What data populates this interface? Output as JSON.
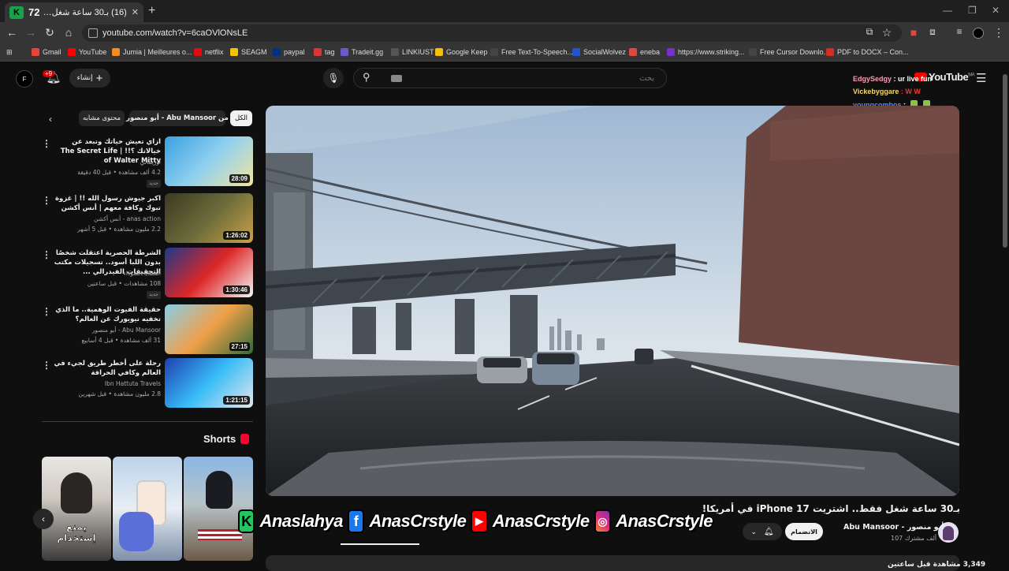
{
  "browser": {
    "tab_title": "(16) بـ30 ساعة شغل فقط...",
    "tab_badge": "72",
    "url": "youtube.com/watch?v=6caOVlONsLE",
    "bookmarks": [
      {
        "label": "Gmail",
        "color": "#ea4335"
      },
      {
        "label": "YouTube",
        "color": "#ff0000"
      },
      {
        "label": "Jumia | Meilleures o...",
        "color": "#f68b1e"
      },
      {
        "label": "netflix",
        "color": "#e50914"
      },
      {
        "label": "SEAGM",
        "color": "#f5c400"
      },
      {
        "label": "paypal",
        "color": "#003087"
      },
      {
        "label": "tag",
        "color": "#d33"
      },
      {
        "label": "Tradeit.gg",
        "color": "#6a5acd"
      },
      {
        "label": "LINKIUST",
        "color": "#555"
      },
      {
        "label": "Google Keep",
        "color": "#fbbc04"
      },
      {
        "label": "Free Text-To-Speech...",
        "color": "#444"
      },
      {
        "label": "SocialWolvez",
        "color": "#2255cc"
      },
      {
        "label": "eneba",
        "color": "#e0483d"
      },
      {
        "label": "https://www.striking...",
        "color": "#7a2fd0"
      },
      {
        "label": "Free Cursor Downlo...",
        "color": "#444"
      },
      {
        "label": "PDF to DOCX – Con...",
        "color": "#d62d20"
      }
    ]
  },
  "header": {
    "avatar_letter": "F",
    "notif_count": "+9",
    "create_label": "إنشاء",
    "search_placeholder": "بحث",
    "logo_text": "YouTube",
    "logo_region": "MA"
  },
  "chat": [
    {
      "user": "EdgySedgy",
      "msg": ": ur live fun",
      "color": "#ff9bb3"
    },
    {
      "user": "Vickebyggare",
      "msg": ":  W  W",
      "color": "#f5d76e"
    },
    {
      "user": "youngcombos",
      "msg": ":",
      "color": "#4f8cff"
    }
  ],
  "chips": {
    "all": "الكل",
    "from_channel": "من Abu Mansoor - أبو منصور",
    "related": "محتوى مشابه"
  },
  "related": [
    {
      "title": "ازاي تعيش حياتك وتبعد عن خيالاتك ؟!! | The Secret Life of Walter Mitty",
      "channel": "أوريماتي",
      "meta": "4.2 ألف مشاهدة • قبل 40 دقيقة",
      "badge": "جديد",
      "duration": "28:09"
    },
    {
      "title": "اكبر جيوش رسول الله !! | غزوة تبوك وكافة معهم | أنس أكشن",
      "channel": "anas action - أنس أكشن",
      "meta": "2.2 مليون مشاهدة • قبل 5 أشهر",
      "badge": "",
      "duration": "1:26:02"
    },
    {
      "title": "الشرطة الحصرية اعتقلت شخصًا بدون اللبا أسود.. تسجيلات مكتب التحقيقات الفيدرالي ...",
      "channel": "القضايا السوداء",
      "meta": "108 مشاهدات • قبل ساعتين",
      "badge": "جديد",
      "duration": "1:30:46"
    },
    {
      "title": "حقيقة الفيوت الوهمية.. ما الذي تخفيه نيويورك عن العالم؟",
      "channel": "Abu Mansoor - أبو منصور",
      "meta": "31 ألف مشاهدة • قبل 4 أسابيع",
      "badge": "",
      "duration": "27:15"
    },
    {
      "title": "رحلة على أخطر طريق لجيء في العالم وكافي الحراقة",
      "channel": "Ibn Hattuta Travels",
      "meta": "2.8 مليون مشاهدة • قبل شهرين",
      "badge": "",
      "duration": "1:21:15"
    }
  ],
  "shorts": {
    "label": "Shorts",
    "items": [
      {
        "caption": "يمنع إستخدام"
      },
      {
        "caption": ""
      },
      {
        "caption": ""
      }
    ]
  },
  "video": {
    "title": "بـ30 ساعة شغل فقط.. اشتريت iPhone 17 في أمريكا!",
    "channel": "Abu Mansoor - أبو منصور",
    "subscribers": "107 ألف مشترك",
    "subscribe_label": "الانضمام",
    "views": "3,349 مشاهدة قبل ساعتين"
  },
  "overlay": {
    "brand_letter": "K",
    "handle1": "Anaslahya",
    "handle2": "AnasCrstyle",
    "handle3": "AnasCrstyle",
    "handle4": "AnasCrstyle"
  }
}
